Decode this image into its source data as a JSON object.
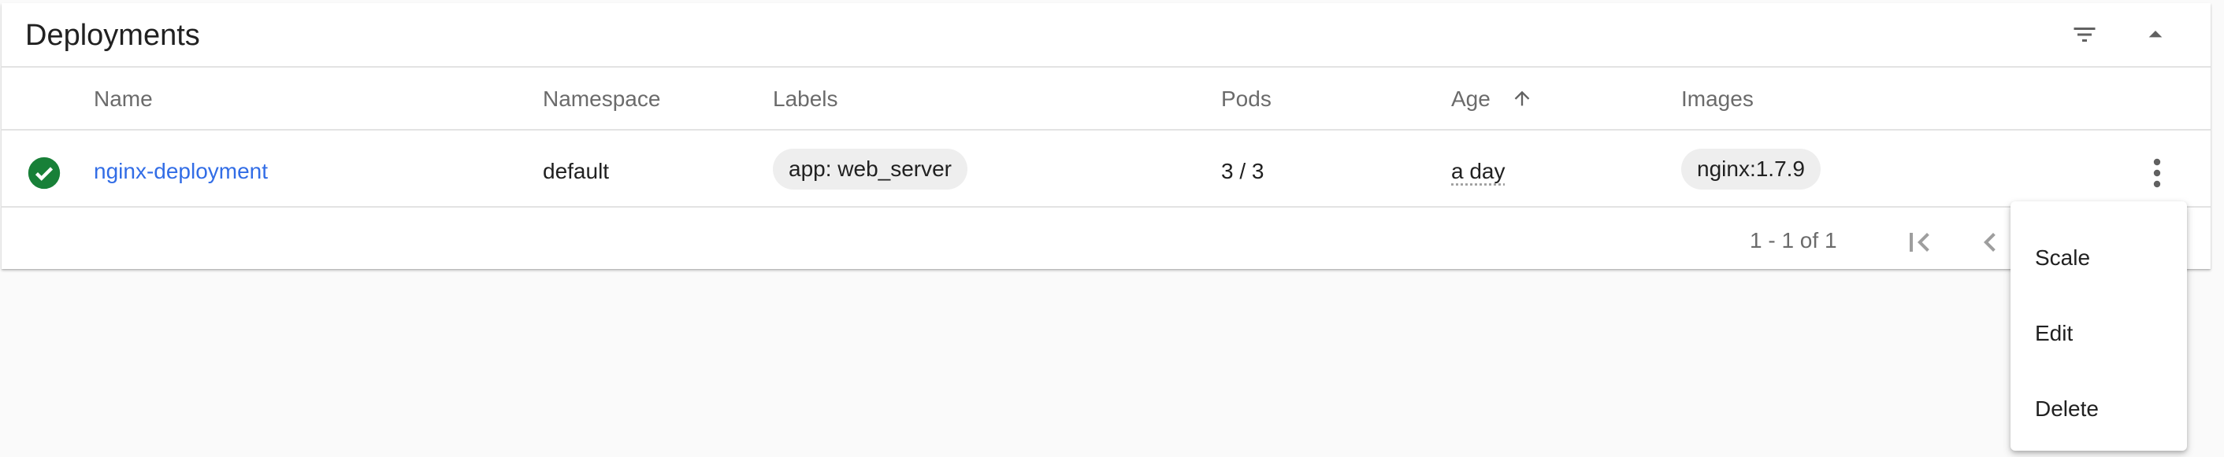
{
  "card": {
    "title": "Deployments"
  },
  "header_actions": {
    "filter_icon": "filter-list-icon",
    "collapse_icon": "arrow-drop-up-icon"
  },
  "table": {
    "columns": [
      "Name",
      "Namespace",
      "Labels",
      "Pods",
      "Age",
      "Images"
    ],
    "sort": {
      "column": "Age",
      "direction": "ascending",
      "icon": "arrow-upward-icon"
    },
    "rows": [
      {
        "status_icon": "check-circle-icon",
        "status_color": "#188038",
        "name": "nginx-deployment",
        "namespace": "default",
        "labels": [
          "app: web_server"
        ],
        "pods": "3 / 3",
        "age": "a day",
        "images": [
          "nginx:1.7.9"
        ],
        "actions_icon": "more-vert-icon"
      }
    ]
  },
  "pagination": {
    "range_text": "1 - 1 of 1",
    "first_icon": "first-page-icon",
    "prev_icon": "chevron-left-icon"
  },
  "action_menu": {
    "items": [
      "Scale",
      "Edit",
      "Delete"
    ]
  },
  "colors": {
    "link": "#326de6",
    "success": "#188038",
    "chip_bg": "#eeeeee",
    "muted_text": "#6b6b6b"
  }
}
